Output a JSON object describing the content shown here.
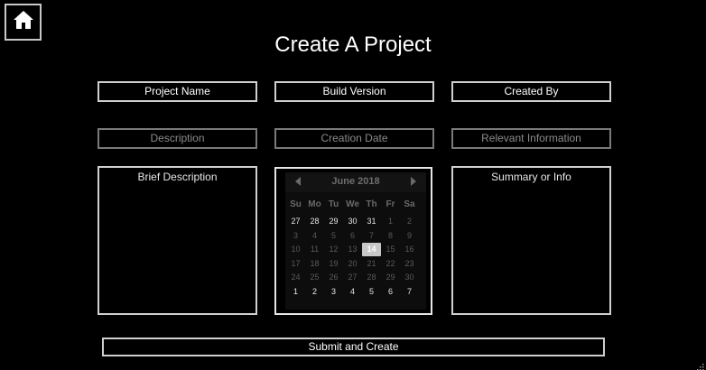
{
  "page": {
    "title": "Create A Project"
  },
  "home": {
    "icon": "home-icon"
  },
  "row1": {
    "project_name": "Project Name",
    "build_version": "Build Version",
    "created_by": "Created By"
  },
  "row2": {
    "description": "Description",
    "creation_date": "Creation Date",
    "relevant_info": "Relevant Information"
  },
  "left_box": {
    "label": "Brief Description"
  },
  "right_box": {
    "label": "Summary or Info"
  },
  "calendar": {
    "month": "June 2018",
    "prev_icon": "chevron-left-icon",
    "next_icon": "chevron-right-icon",
    "dow": [
      "Su",
      "Mo",
      "Tu",
      "We",
      "Th",
      "Fr",
      "Sa"
    ],
    "weeks": [
      [
        "27",
        "28",
        "29",
        "30",
        "31",
        "1",
        "2"
      ],
      [
        "3",
        "4",
        "5",
        "6",
        "7",
        "8",
        "9"
      ],
      [
        "10",
        "11",
        "12",
        "13",
        "14",
        "15",
        "16"
      ],
      [
        "17",
        "18",
        "19",
        "20",
        "21",
        "22",
        "23"
      ],
      [
        "24",
        "25",
        "26",
        "27",
        "28",
        "29",
        "30"
      ],
      [
        "1",
        "2",
        "3",
        "4",
        "5",
        "6",
        "7"
      ]
    ],
    "selected": "14"
  },
  "submit": {
    "label": "Submit and Create"
  }
}
